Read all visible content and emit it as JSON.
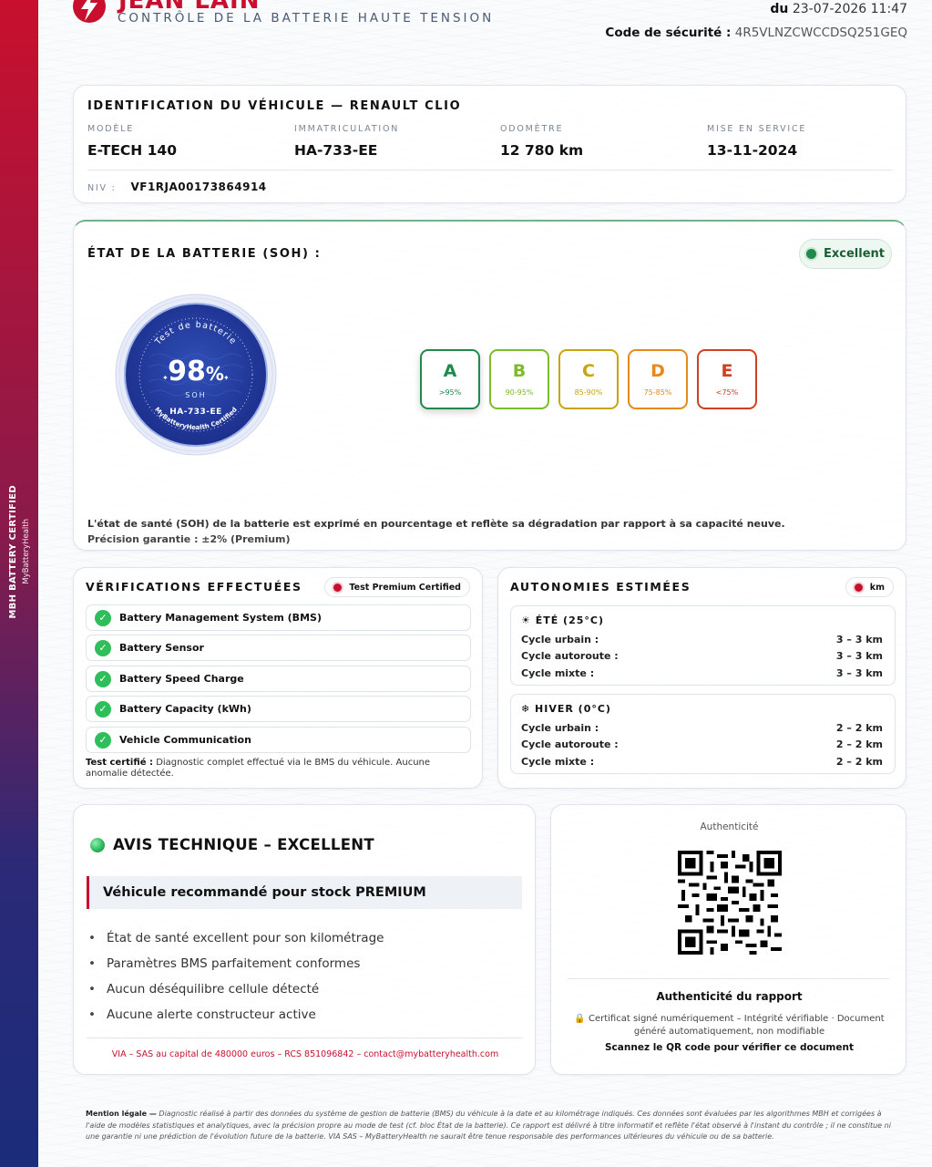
{
  "header": {
    "brand_name": "JEAN LAIN",
    "brand_subtitle": "CONTRÔLE DE LA BATTERIE HAUTE TENSION",
    "date_prefix": "du",
    "date_value": "23-07-2026 11:47",
    "security_label": "Code de sécurité :",
    "security_code": "4R5VLNZCWCCDSQ251GEQ"
  },
  "side_band": {
    "line1": "MBH BATTERY CERTIFIED",
    "line2": "MyBatteryHealth"
  },
  "identification": {
    "title": "IDENTIFICATION DU VÉHICULE — RENAULT CLIO",
    "fields": [
      {
        "label": "MODÈLE",
        "value": "E-TECH 140"
      },
      {
        "label": "IMMATRICULATION",
        "value": "HA-733-EE"
      },
      {
        "label": "ODOMÈTRE",
        "value": "12 780 km"
      },
      {
        "label": "MISE EN SERVICE",
        "value": "13-11-2024"
      }
    ],
    "niv_label": "NIV :",
    "niv_value": "VF1RJA00173864914"
  },
  "soh": {
    "title": "ÉTAT DE LA BATTERIE (SOH) :",
    "status": "Excellent",
    "seal_ring_text": "Test de batterie",
    "seal_bottom_text": "MyBatteryHealth Certified",
    "value": "98",
    "unit": "%",
    "seal_label": "SOH",
    "seal_plate": "HA-733-EE",
    "grades": [
      {
        "letter": "A",
        "range": ">95%",
        "color": "#1f8a4c"
      },
      {
        "letter": "B",
        "range": "90-95%",
        "color": "#7cbb2a"
      },
      {
        "letter": "C",
        "range": "85-90%",
        "color": "#c9a40f"
      },
      {
        "letter": "D",
        "range": "75-85%",
        "color": "#e6891a"
      },
      {
        "letter": "E",
        "range": "<75%",
        "color": "#d0401e"
      }
    ],
    "description": "L'état de santé (SOH) de la batterie est exprimé en pourcentage et reflète sa dégradation par rapport à sa capacité neuve.",
    "precision": "Précision garantie : ±2% (Premium)"
  },
  "checks": {
    "title": "VÉRIFICATIONS EFFECTUÉES",
    "badge": "Test Premium Certified",
    "items": [
      "Battery Management System (BMS)",
      "Battery Sensor",
      "Battery Speed Charge",
      "Battery Capacity (kWh)",
      "Vehicle Communication"
    ],
    "note_label": "Test certifié :",
    "note_text": "Diagnostic complet effectué via le BMS du véhicule. Aucune anomalie détectée."
  },
  "autonomies": {
    "title": "AUTONOMIES ESTIMÉES",
    "badge": "km",
    "seasons": [
      {
        "title": "☀ ÉTÉ (25°C)",
        "rows": [
          {
            "label": "Cycle urbain :",
            "value": "3 – 3 km"
          },
          {
            "label": "Cycle autoroute :",
            "value": "3 – 3 km"
          },
          {
            "label": "Cycle mixte :",
            "value": "3 – 3 km"
          }
        ]
      },
      {
        "title": "❄ HIVER (0°C)",
        "rows": [
          {
            "label": "Cycle urbain :",
            "value": "2 – 2 km"
          },
          {
            "label": "Cycle autoroute :",
            "value": "2 – 2 km"
          },
          {
            "label": "Cycle mixte :",
            "value": "2 – 2 km"
          }
        ]
      }
    ]
  },
  "avis": {
    "title": "AVIS TECHNIQUE – EXCELLENT",
    "recommendation": "Véhicule recommandé pour stock PREMIUM",
    "points": [
      "État de santé excellent pour son kilométrage",
      "Paramètres BMS parfaitement conformes",
      "Aucun déséquilibre cellule détecté",
      "Aucune alerte constructeur active"
    ],
    "footer": "VIA – SAS au capital de 480000 euros – RCS 851096842 – contact@mybatteryhealth.com"
  },
  "authenticity": {
    "top_label": "Authenticité",
    "title": "Authenticité du rapport",
    "cert_text": "🔒 Certificat signé numériquement – Intégrité vérifiable · Document généré automatiquement, non modifiable",
    "scan_text": "Scannez le QR code pour vérifier ce document"
  },
  "mention": {
    "label": "Mention légale —",
    "text": "Diagnostic réalisé à partir des données du système de gestion de batterie (BMS) du véhicule à la date et au kilométrage indiqués. Ces données sont évaluées par les algorithmes MBH et corrigées à l'aide de modèles statistiques et analytiques, avec la précision propre au mode de test (cf. bloc État de la batterie). Ce rapport est délivré à titre informatif et reflète l'état observé à l'instant du contrôle ; il ne constitue ni une garantie ni une prédiction de l'évolution future de la batterie. VIA SAS – MyBatteryHealth ne saurait être tenue responsable des performances ultérieures du véhicule ou de sa batterie."
  }
}
